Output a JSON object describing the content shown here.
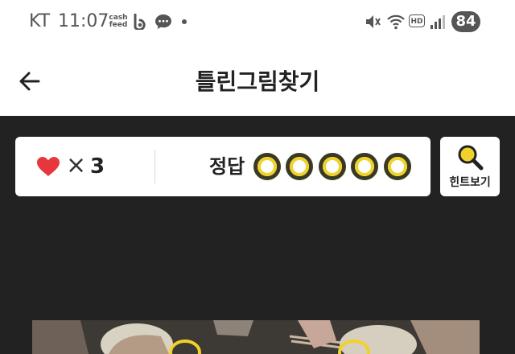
{
  "status_bar": {
    "carrier": "KT",
    "time": "11:07",
    "cashfeed_label": "cash feed",
    "battery": "84",
    "hd_label": "HD",
    "icons": [
      "b-icon",
      "chat-icon",
      "mute-icon",
      "wifi-icon",
      "hd-icon",
      "signal-icon"
    ]
  },
  "header": {
    "title": "틀린그림찾기",
    "back_icon": "arrow-left-icon"
  },
  "info_card": {
    "times_sign": "×",
    "lives": "3",
    "answer_label": "정답",
    "answer_total": 5,
    "answer_found": 0
  },
  "hint": {
    "label": "힌트보기",
    "icon": "magnifier-icon"
  },
  "colors": {
    "background": "#222222",
    "heart": "#e8363f",
    "accent_yellow": "#f0d22b",
    "card": "#ffffff"
  }
}
